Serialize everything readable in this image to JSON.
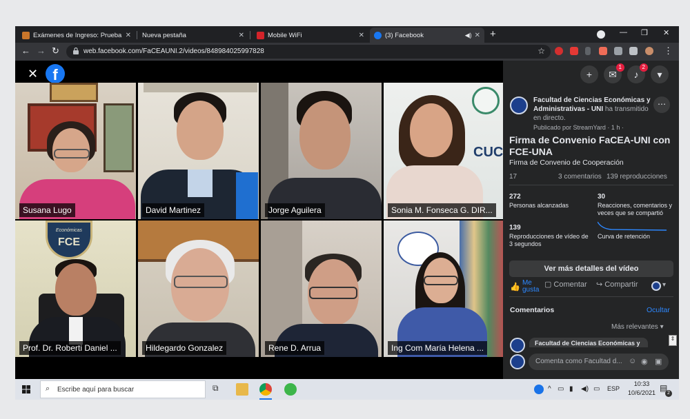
{
  "browser": {
    "tabs": [
      {
        "title": "Exámenes de Ingreso: Prueba de",
        "active": false
      },
      {
        "title": "Nueva pestaña",
        "active": false
      },
      {
        "title": "Mobile WiFi",
        "active": false
      },
      {
        "title": "(3) Facebook",
        "active": true
      }
    ],
    "new_tab": "+",
    "url": "web.facebook.com/FaCEAUNI.2/videos/848984025997828"
  },
  "video": {
    "participants": [
      {
        "name": "Susana Lugo"
      },
      {
        "name": "David Martinez"
      },
      {
        "name": "Jorge Aguilera"
      },
      {
        "name": "Sonia M. Fonseca G. DIR..."
      },
      {
        "name": "Prof. Dr. Roberti Daniel ..."
      },
      {
        "name": "Hildegardo Gonzalez"
      },
      {
        "name": "Rene D. Arrua"
      },
      {
        "name": "Ing Com María Helena ..."
      }
    ],
    "background_text": {
      "sign_economicas": "Económicas",
      "sign_fce": "FCE",
      "sign_cuc": "CUC"
    }
  },
  "header": {
    "messenger_badge": "1",
    "notifications_badge": "2"
  },
  "post": {
    "page_name": "Facultad de Ciencias Económicas y Administrativas - UNI",
    "action_text": " ha transmitido en directo.",
    "meta": "Publicado por StreamYard · 1 h ·",
    "title": "Firma de Convenio FaCEA-UNI con FCE-UNA",
    "subtitle": "Firma de Convenio de Cooperación",
    "reactions_count": "17",
    "comments_count": "3 comentarios",
    "views_count": "139 reproducciones"
  },
  "stats": [
    {
      "value": "272",
      "label": "Personas alcanzadas"
    },
    {
      "value": "30",
      "label": "Reacciones, comentarios y veces que se compartió"
    },
    {
      "value": "139",
      "label": "Reproducciones de vídeo de 3 segundos"
    },
    {
      "value": "",
      "label": "Curva de retención"
    }
  ],
  "details_button": "Ver más detalles del vídeo",
  "actions": {
    "like": "Me gusta",
    "comment": "Comentar",
    "share": "Compartir"
  },
  "comments": {
    "heading": "Comentarios",
    "hide": "Ocultar",
    "sort": "Más relevantes",
    "first_author": "Facultad de Ciencias Económicas y",
    "input_placeholder": "Comenta como Facultad d..."
  },
  "taskbar": {
    "search_placeholder": "Escribe aquí para buscar",
    "language": "ESP",
    "time": "10:33",
    "date": "10/6/2021",
    "notif_count": "2"
  },
  "colors": {
    "facebook_blue": "#1877f2",
    "panel_bg": "#242526",
    "badge_red": "#e41e3f"
  }
}
